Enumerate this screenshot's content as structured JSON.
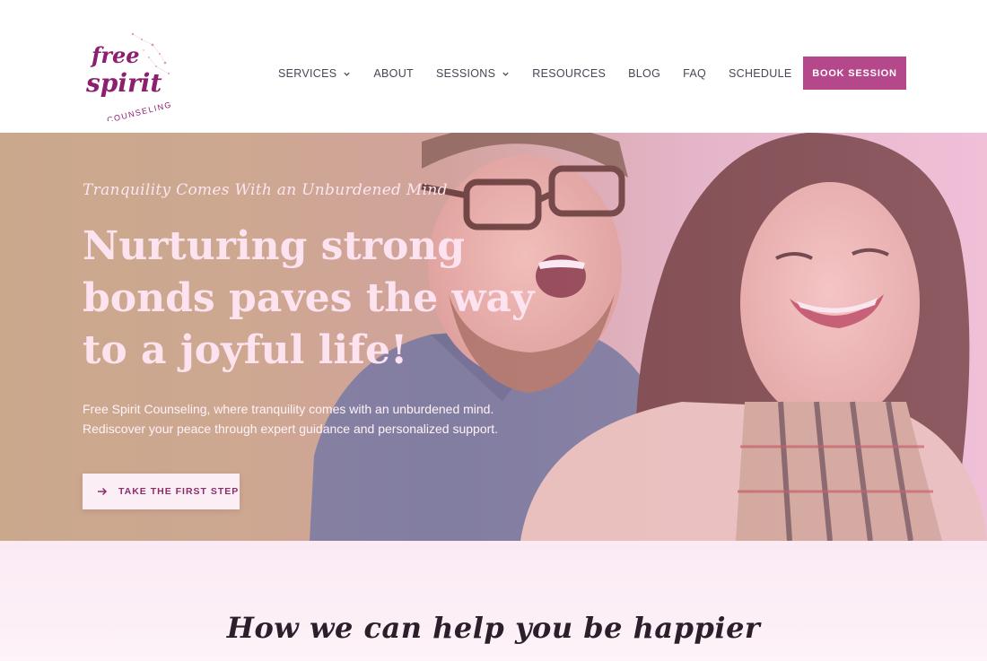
{
  "logo": {
    "line1": "free",
    "line2": "spirit",
    "line3": "COUNSELING",
    "color": "#8c1f6e"
  },
  "nav": {
    "items": [
      {
        "label": "SERVICES",
        "has_dropdown": true
      },
      {
        "label": "ABOUT",
        "has_dropdown": false
      },
      {
        "label": "SESSIONS",
        "has_dropdown": true
      },
      {
        "label": "RESOURCES",
        "has_dropdown": false
      },
      {
        "label": "BLOG",
        "has_dropdown": false
      },
      {
        "label": "FAQ",
        "has_dropdown": false
      },
      {
        "label": "SCHEDULE",
        "has_dropdown": false
      }
    ],
    "book_label": "BOOK SESSION"
  },
  "hero": {
    "tagline": "Tranquility Comes With an Unburdened Mind",
    "headline": [
      "Nurturing strong",
      "bonds paves the way",
      "to a joyful life!"
    ],
    "subtext": [
      "Free Spirit Counseling, where tranquility comes with an unburdened mind.",
      "Rediscover your peace through expert guidance and personalized support."
    ],
    "cta_label": "TAKE THE FIRST STEP",
    "cta_icon": "arrow-right-icon"
  },
  "section": {
    "title": "How we can help you be happier"
  },
  "colors": {
    "accent": "#b5488a",
    "nav_text": "#4a4655",
    "cta_text": "#8c2e6c"
  }
}
